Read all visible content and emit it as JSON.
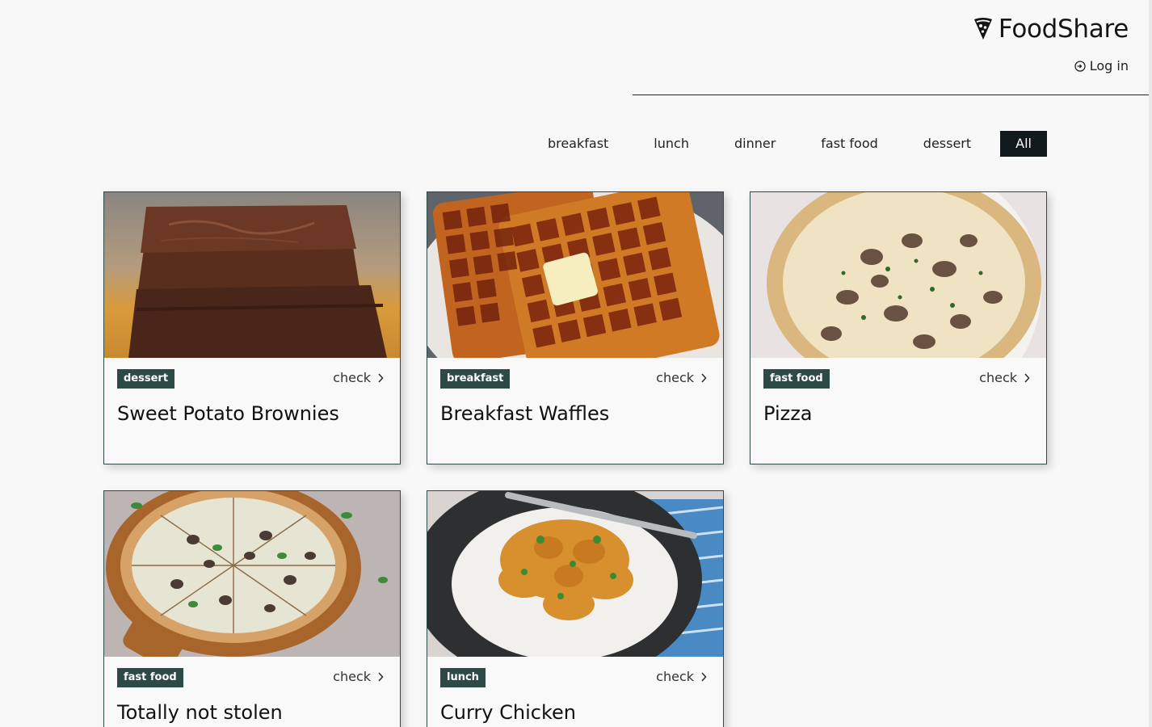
{
  "brand": {
    "name": "FoodShare",
    "icon": "pizza-slice-icon"
  },
  "auth": {
    "login_label": "Log in",
    "icon": "login-icon"
  },
  "filters": [
    {
      "label": "breakfast",
      "active": false
    },
    {
      "label": "lunch",
      "active": false
    },
    {
      "label": "dinner",
      "active": false
    },
    {
      "label": "fast food",
      "active": false
    },
    {
      "label": "dessert",
      "active": false
    },
    {
      "label": "All",
      "active": true
    }
  ],
  "recipes": [
    {
      "category": "dessert",
      "title": "Sweet Potato Brownies",
      "action": "check",
      "image": "brownies-photo"
    },
    {
      "category": "breakfast",
      "title": "Breakfast Waffles",
      "action": "check",
      "image": "waffles-photo"
    },
    {
      "category": "fast food",
      "title": "Pizza",
      "action": "check",
      "image": "mushroom-pizza-photo"
    },
    {
      "category": "fast food",
      "title": "Totally not stolen",
      "action": "check",
      "image": "pizza-board-photo"
    },
    {
      "category": "lunch",
      "title": "Curry Chicken",
      "action": "check",
      "image": "curry-rice-photo"
    }
  ],
  "colors": {
    "background": "#f8f8f8",
    "tag": "#2e4a47",
    "active_filter": "#10191b",
    "card_border": "#2f4a47"
  }
}
